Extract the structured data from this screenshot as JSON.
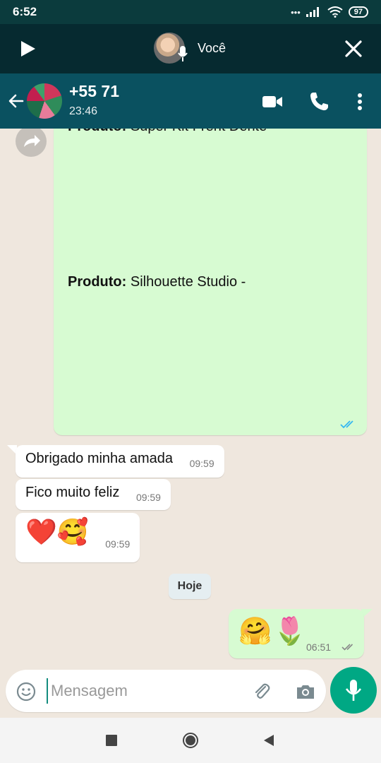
{
  "status_bar": {
    "time": "6:52",
    "battery": "97"
  },
  "audio_bar": {
    "speaker": "Você"
  },
  "header": {
    "contact_name": "+55 71",
    "contact_status": "23:46"
  },
  "messages": {
    "product_cut": {
      "label": "Produto:",
      "text": "Super Kit Frent Dente"
    },
    "product_line": {
      "label": "Produto:",
      "text": "Silhouette Studio -"
    },
    "incoming": [
      {
        "text": "Obrigado minha amada",
        "time": "09:59"
      },
      {
        "text": "Fico muito feliz",
        "time": "09:59"
      },
      {
        "text": "❤️🥰",
        "time": "09:59"
      }
    ],
    "date_divider": "Hoje",
    "outgoing": {
      "text": "🤗🌷",
      "time": "06:51"
    }
  },
  "input": {
    "placeholder": "Mensagem"
  },
  "colors": {
    "header": "#0a5160",
    "outgoing_bubble": "#d7fbd2",
    "accent": "#00a884",
    "tick_read": "#34b7f1"
  }
}
